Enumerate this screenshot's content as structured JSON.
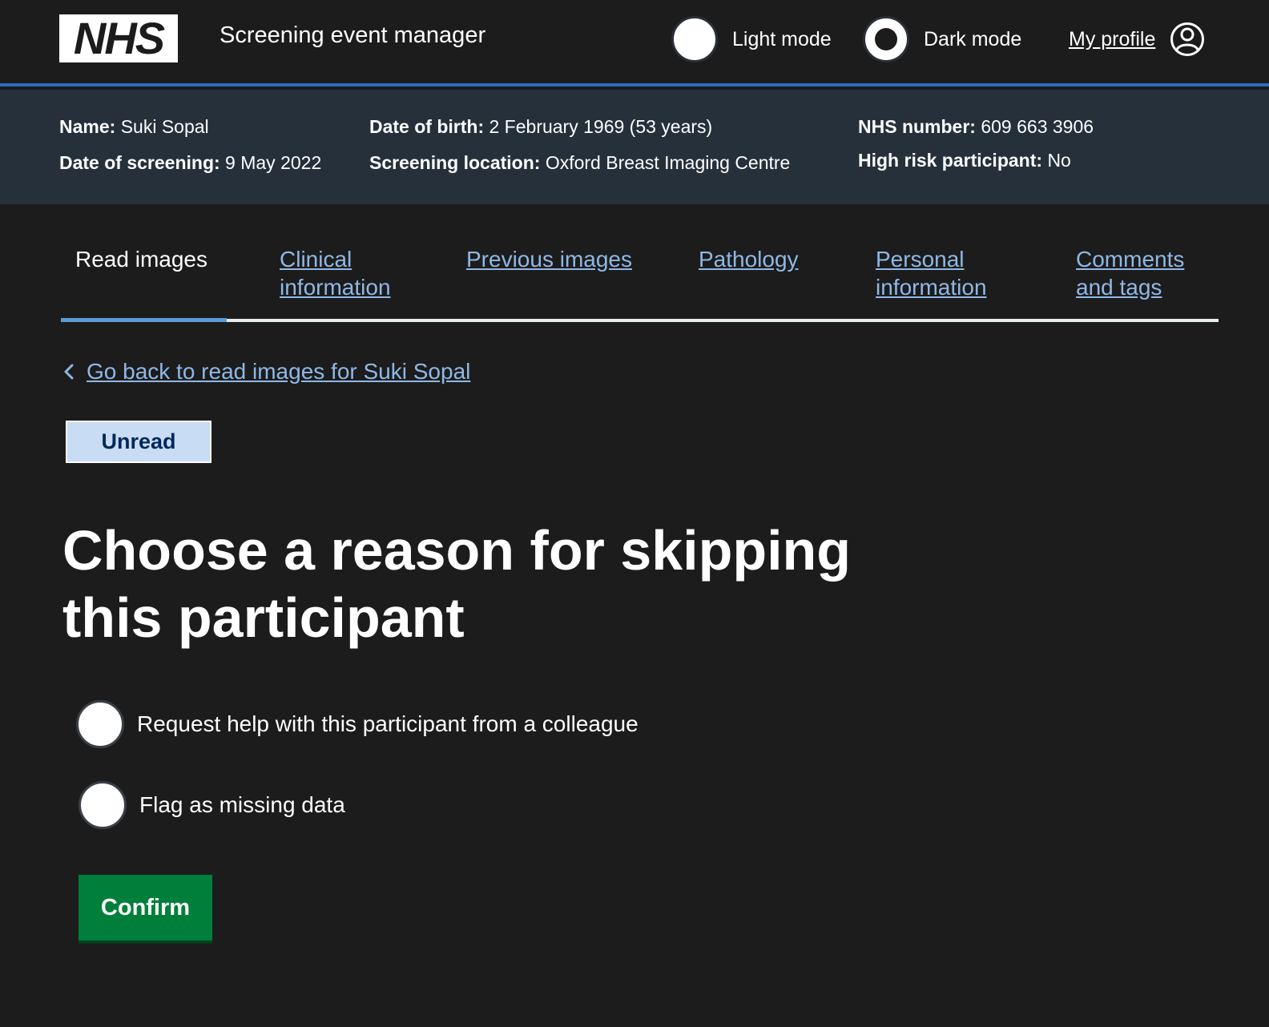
{
  "header": {
    "logo_text": "NHS",
    "service_name": "Screening event manager",
    "light_mode_label": "Light mode",
    "dark_mode_label": "Dark mode",
    "selected_mode": "Dark mode",
    "profile_label": "My profile"
  },
  "participant": {
    "name_label": "Name:",
    "name": "Suki Sopal",
    "dob_label": "Date of birth:",
    "dob": "2 February 1969 (53 years)",
    "nhs_number_label": "NHS number:",
    "nhs_number": "609 663 3906",
    "screening_date_label": "Date of screening:",
    "screening_date": "9 May 2022",
    "location_label": "Screening location:",
    "location": "Oxford Breast Imaging Centre",
    "high_risk_label": "High risk participant:",
    "high_risk": "No"
  },
  "tabs": [
    {
      "label": "Read images",
      "active": true
    },
    {
      "label": "Clinical information",
      "active": false
    },
    {
      "label": "Previous images",
      "active": false
    },
    {
      "label": "Pathology",
      "active": false
    },
    {
      "label": "Personal information",
      "active": false
    },
    {
      "label": "Comments and tags",
      "active": false
    }
  ],
  "back_link": "Go back to read images for Suki Sopal",
  "status_tag": "Unread",
  "page_title": "Choose a reason for skipping this participant",
  "options": [
    {
      "label": "Request help with this participant from a colleague",
      "checked": false
    },
    {
      "label": "Flag as missing data",
      "checked": false
    }
  ],
  "confirm_label": "Confirm",
  "colors": {
    "background": "#1c1c1c",
    "banner": "#25303a",
    "link": "#8fb8e6",
    "accent_blue": "#2c6bc4",
    "button_green": "#007f3b",
    "tag_bg": "#c8dcf3"
  }
}
